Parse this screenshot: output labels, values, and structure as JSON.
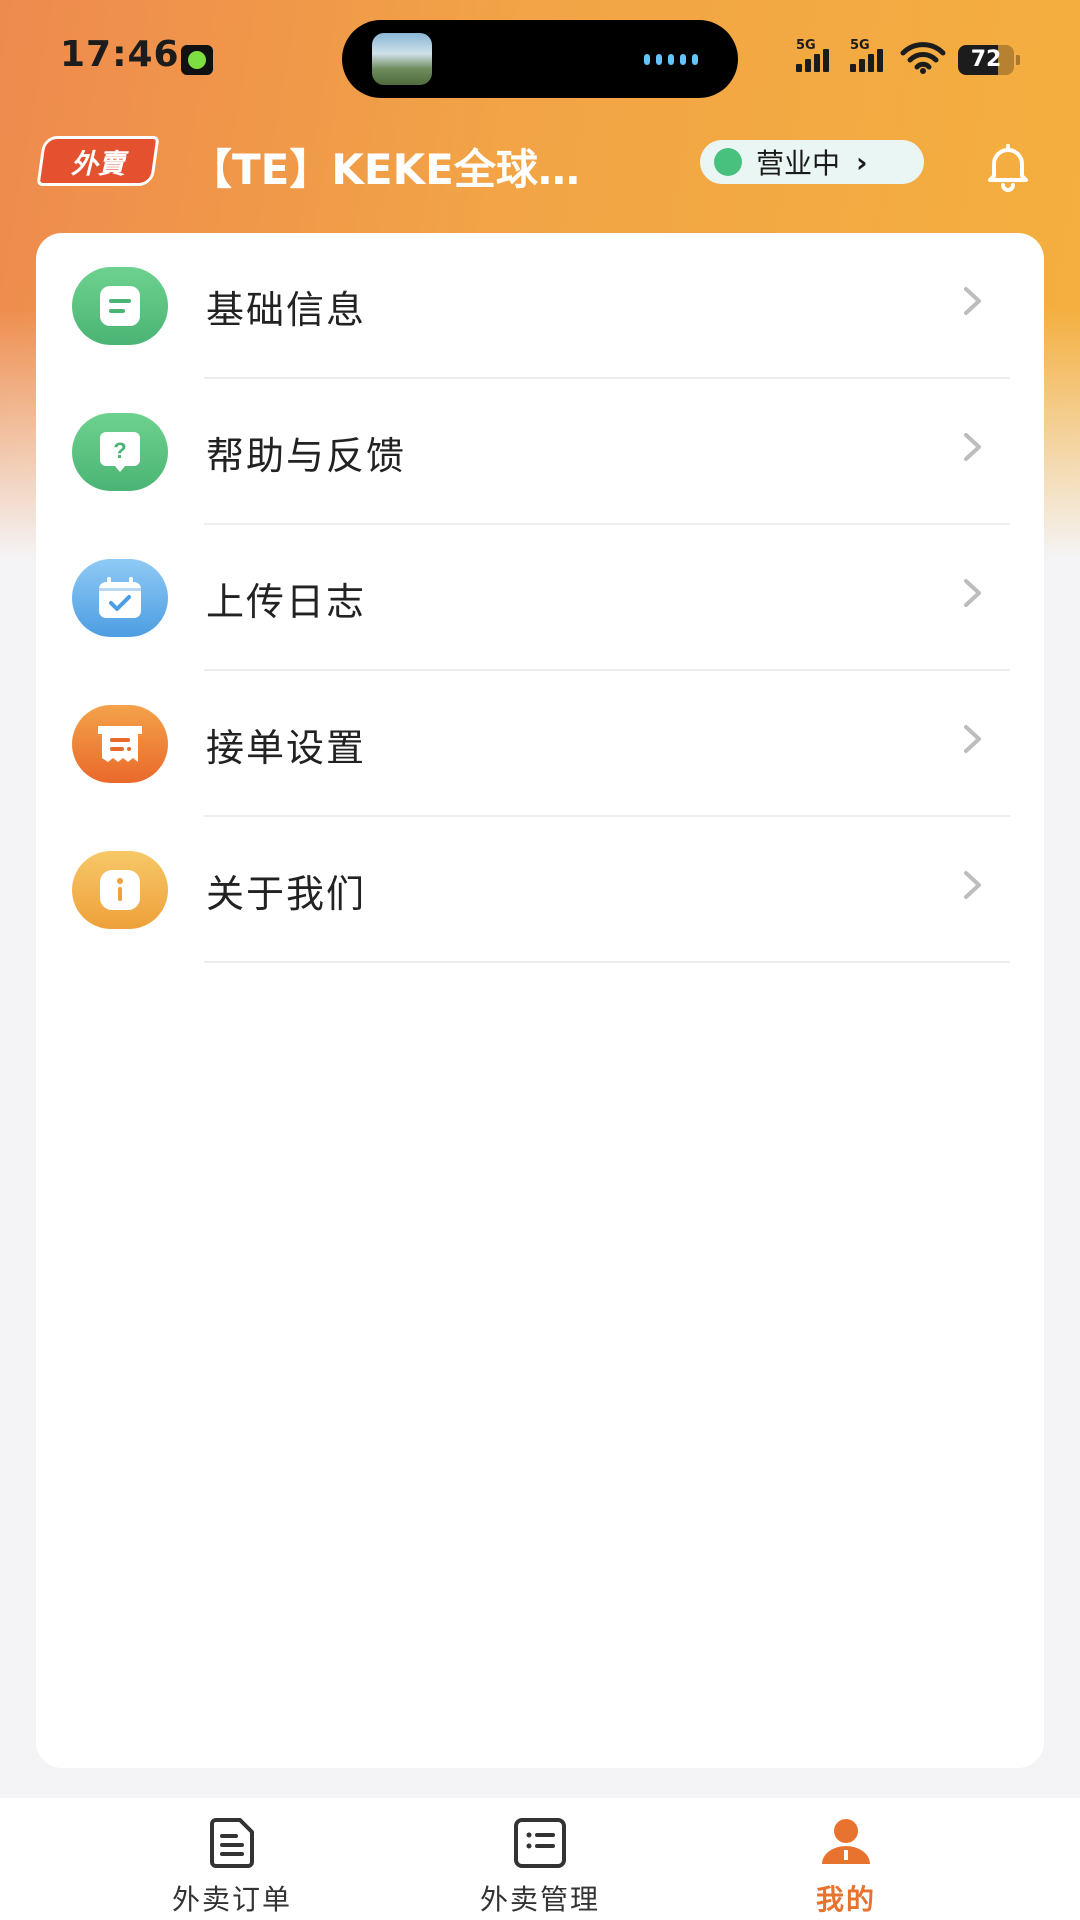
{
  "status_bar": {
    "time": "17:46",
    "signal1_label": "5G",
    "signal2_label": "5G",
    "battery": "72",
    "battery_level": 0.72
  },
  "header": {
    "badge": "外賣",
    "store_name": "【TE】KEKE全球…",
    "status": "营业中",
    "status_color": "#48c17f",
    "icons": {
      "notification": "bell-icon"
    }
  },
  "menu": {
    "items": [
      {
        "label": "基础信息",
        "icon": "document-icon",
        "colors": [
          "#6ed28f",
          "#4bb474"
        ]
      },
      {
        "label": "帮助与反馈",
        "icon": "help-icon",
        "colors": [
          "#6ed28f",
          "#4bb474"
        ]
      },
      {
        "label": "上传日志",
        "icon": "calendar-check-icon",
        "colors": [
          "#8fcaf5",
          "#4d9de2"
        ]
      },
      {
        "label": "接单设置",
        "icon": "receipt-icon",
        "colors": [
          "#f4a24a",
          "#e9692b"
        ]
      },
      {
        "label": "关于我们",
        "icon": "info-icon",
        "colors": [
          "#f7c868",
          "#eea03a"
        ]
      }
    ]
  },
  "tabs": [
    {
      "label": "外卖订单",
      "icon": "order-doc-icon",
      "active": false
    },
    {
      "label": "外卖管理",
      "icon": "list-manage-icon",
      "active": false
    },
    {
      "label": "我的",
      "icon": "person-icon",
      "active": true
    }
  ],
  "theme": {
    "accent": "#e8732f",
    "gradient_start": "#ee8a4e",
    "gradient_end": "#f4b03e"
  }
}
